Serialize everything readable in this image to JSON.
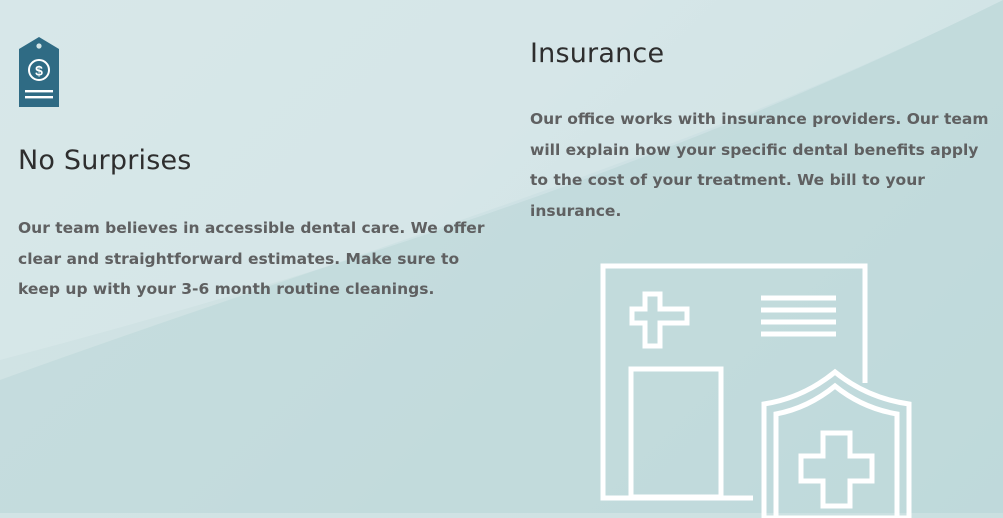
{
  "sections": {
    "no_surprises": {
      "icon": "price-tag-dollar-icon",
      "title": "No Surprises",
      "body": "Our team believes in accessible dental care. We offer clear and straightforward estimates. Make sure to keep up with your 3-6 month routine cleanings."
    },
    "insurance": {
      "title": "Insurance",
      "body": "Our office works with insurance providers. Our team will explain how your specific dental benefits apply to the cost of your treatment. We bill to your insurance.",
      "illustration": "medical-document-shield-icon"
    }
  },
  "colors": {
    "background": "#cfe2e3",
    "icon": "#2f6b84",
    "heading": "#2e2e2e",
    "body_text": "#5f6061",
    "illustration": "#ffffff"
  }
}
